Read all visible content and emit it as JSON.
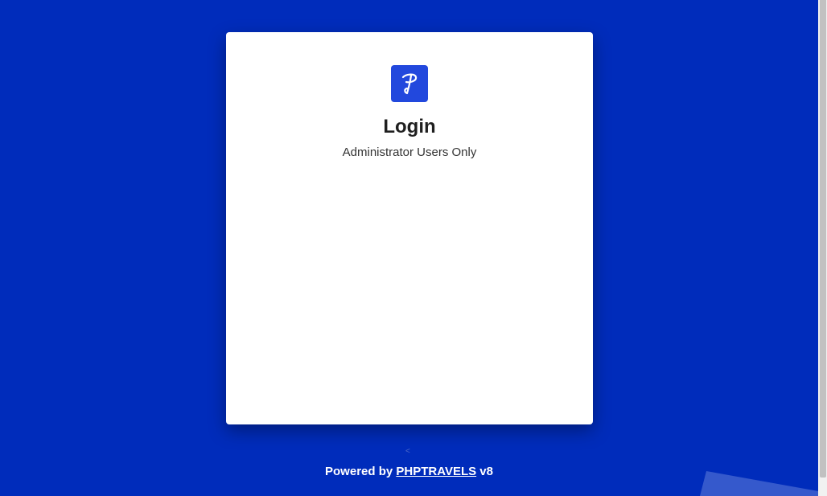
{
  "login_card": {
    "title": "Login",
    "subtitle": "Administrator Users Only",
    "logo_icon": "phptravels-logo-icon"
  },
  "back_mark": "<",
  "footer": {
    "powered_by": "Powered by",
    "brand_link": "PHPTRAVELS",
    "version": "v8"
  },
  "colors": {
    "background": "#002cbb",
    "card": "#ffffff",
    "logo_bg": "#2248dd",
    "text_dark": "#1f1f1f"
  }
}
